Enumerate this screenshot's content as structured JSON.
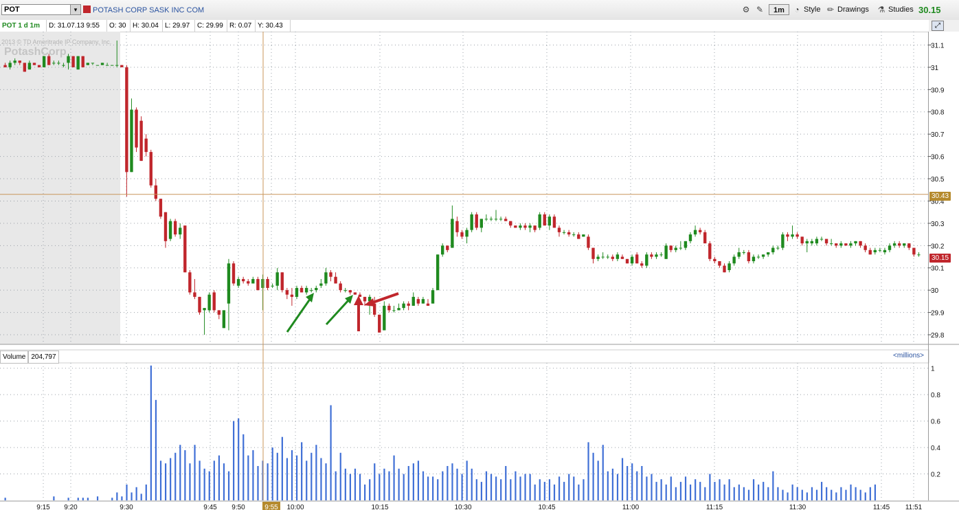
{
  "toolbar": {
    "symbol": "POT",
    "company": "POTASH CORP SASK INC COM",
    "timeframe_button": "1m",
    "style_label": "Style",
    "drawings_label": "Drawings",
    "studies_label": "Studies",
    "last_price": "30.15"
  },
  "info_bar": {
    "title": "POT 1 d 1m",
    "date": "D: 31.07.13 9:55",
    "open": "O: 30",
    "high": "H: 30.04",
    "low": "L: 29.97",
    "close": "C: 29.99",
    "range": "R: 0.07",
    "y": "Y: 30.43"
  },
  "watermark": {
    "copyright": "2013 © TD Ameritrade IP Company, Inc.",
    "logo": "PotashCorp"
  },
  "volume_panel": {
    "label": "Volume",
    "value": "204,797",
    "units": "<millions>"
  },
  "colors": {
    "up": "#1f8a1f",
    "down": "#c0262c",
    "volume": "#3f6fd6",
    "crosshair": "#c9955a",
    "grid": "#9aa0a8",
    "shade": "#e8e8e8"
  },
  "icons": [
    "dropdown-icon",
    "gear-icon",
    "wrench-icon",
    "bell-icon",
    "pencil-icon",
    "studies-icon",
    "expand-icon"
  ],
  "chart_data": {
    "type": "candlestick",
    "price_axis": {
      "ticks": [
        29.8,
        29.9,
        30,
        30.1,
        30.2,
        30.3,
        30.4,
        30.5,
        30.6,
        30.7,
        30.8,
        30.9,
        31,
        31.1
      ],
      "ylim": [
        29.76,
        31.16
      ]
    },
    "volume_axis": {
      "ticks": [
        0.2,
        0.4,
        0.6,
        0.8,
        1
      ],
      "labels": [
        "0.2",
        "0.4",
        "0.6",
        "0.8",
        "1"
      ],
      "ylim": [
        0,
        1.04
      ]
    },
    "time_labels": [
      "9:15",
      "9:20",
      "9:30",
      "9:45",
      "9:50",
      "9:55",
      "10:00",
      "10:15",
      "10:30",
      "10:45",
      "11:00",
      "11:15",
      "11:30",
      "11:45",
      "11:51"
    ],
    "crosshair_price": "30.43",
    "crosshair_time": "9:55",
    "last_price_tag": "30.15",
    "candles_ohlc": [
      [
        31.01,
        31.02,
        31.0,
        31.0
      ],
      [
        31.0,
        31.03,
        30.99,
        31.02
      ],
      [
        31.02,
        31.04,
        31.01,
        31.03
      ],
      [
        31.03,
        31.03,
        31.01,
        31.02
      ],
      [
        31.02,
        31.02,
        30.98,
        30.98
      ],
      [
        30.99,
        31.03,
        30.99,
        31.02
      ],
      [
        31.02,
        31.02,
        31.01,
        31.01
      ],
      [
        31.01,
        31.01,
        31.0,
        31.0
      ],
      [
        31.0,
        31.05,
        31.0,
        31.05
      ],
      [
        31.05,
        31.06,
        31.01,
        31.01
      ],
      [
        31.02,
        31.03,
        31.01,
        31.02
      ],
      [
        31.02,
        31.03,
        31.01,
        31.02
      ],
      [
        31.01,
        31.02,
        31.0,
        31.01
      ],
      [
        31.02,
        31.06,
        30.99,
        31.05
      ],
      [
        31.05,
        31.05,
        31.0,
        31.0
      ],
      [
        30.99,
        31.05,
        30.99,
        31.05
      ],
      [
        31.05,
        31.05,
        31.0,
        31.0
      ],
      [
        31.01,
        31.02,
        31.01,
        31.02
      ],
      [
        31.02,
        31.02,
        31.01,
        31.02
      ],
      [
        31.01,
        31.01,
        31.01,
        31.01
      ],
      [
        31.01,
        31.02,
        31.01,
        31.02
      ],
      [
        31.01,
        31.02,
        31.01,
        31.01
      ],
      [
        31.01,
        31.01,
        31.01,
        31.01
      ],
      [
        31.01,
        31.12,
        31.0,
        31.01
      ],
      [
        31.01,
        31.01,
        31.0,
        31.0
      ],
      [
        31.0,
        31.01,
        30.42,
        30.53
      ],
      [
        30.53,
        30.86,
        30.53,
        30.81
      ],
      [
        30.81,
        30.82,
        30.62,
        30.64
      ],
      [
        30.76,
        30.78,
        30.58,
        30.58
      ],
      [
        30.68,
        30.7,
        30.6,
        30.62
      ],
      [
        30.62,
        30.63,
        30.46,
        30.47
      ],
      [
        30.47,
        30.5,
        30.4,
        30.41
      ],
      [
        30.41,
        30.41,
        30.32,
        30.33
      ],
      [
        30.35,
        30.35,
        30.19,
        30.22
      ],
      [
        30.23,
        30.32,
        30.22,
        30.31
      ],
      [
        30.31,
        30.32,
        30.24,
        30.25
      ],
      [
        30.25,
        30.3,
        30.23,
        30.28
      ],
      [
        30.29,
        30.29,
        30.08,
        30.08
      ],
      [
        30.08,
        30.09,
        29.98,
        29.99
      ],
      [
        29.99,
        30.05,
        29.96,
        29.97
      ],
      [
        29.97,
        29.97,
        29.89,
        29.9
      ],
      [
        29.91,
        29.92,
        29.8,
        29.92
      ],
      [
        29.91,
        29.99,
        29.9,
        29.98
      ],
      [
        29.99,
        30.0,
        29.9,
        29.91
      ],
      [
        29.91,
        29.91,
        29.87,
        29.89
      ],
      [
        29.83,
        29.91,
        29.83,
        29.91
      ],
      [
        29.94,
        30.14,
        29.82,
        30.12
      ],
      [
        30.12,
        30.13,
        30.02,
        30.03
      ],
      [
        30.02,
        30.06,
        30.01,
        30.05
      ],
      [
        30.05,
        30.06,
        30.03,
        30.04
      ],
      [
        30.04,
        30.05,
        30.02,
        30.03
      ],
      [
        30.03,
        30.06,
        30.03,
        30.05
      ],
      [
        30.05,
        30.06,
        30.0,
        30.0
      ],
      [
        30.01,
        30.07,
        29.91,
        30.05
      ],
      [
        30.05,
        30.06,
        30.0,
        30.01
      ],
      [
        30.02,
        30.03,
        30.01,
        30.02
      ],
      [
        30.02,
        30.1,
        30.0,
        30.08
      ],
      [
        30.08,
        30.08,
        29.99,
        30.0
      ],
      [
        30.0,
        30.01,
        29.96,
        29.98
      ],
      [
        29.98,
        30.01,
        29.93,
        29.97
      ],
      [
        29.97,
        30.02,
        29.96,
        30.01
      ],
      [
        30.01,
        30.02,
        29.99,
        29.99
      ],
      [
        29.99,
        30.02,
        29.98,
        30.01
      ],
      [
        30.0,
        30.01,
        29.99,
        30.0
      ],
      [
        30.0,
        30.02,
        29.99,
        30.01
      ],
      [
        30.02,
        30.05,
        30.01,
        30.03
      ],
      [
        30.03,
        30.1,
        30.02,
        30.08
      ],
      [
        30.08,
        30.09,
        30.04,
        30.06
      ],
      [
        30.06,
        30.08,
        30.03,
        30.03
      ],
      [
        30.03,
        30.04,
        29.99,
        30.0
      ],
      [
        30.0,
        30.01,
        29.99,
        30.0
      ],
      [
        30.0,
        30.0,
        29.98,
        29.99
      ],
      [
        29.99,
        29.99,
        29.98,
        29.98
      ],
      [
        29.98,
        29.99,
        29.97,
        29.97
      ],
      [
        29.97,
        29.97,
        29.93,
        29.95
      ],
      [
        29.95,
        29.98,
        29.89,
        29.97
      ],
      [
        29.94,
        29.97,
        29.88,
        29.89
      ],
      [
        29.89,
        29.89,
        29.81,
        29.81
      ],
      [
        29.82,
        29.95,
        29.82,
        29.93
      ],
      [
        29.93,
        29.94,
        29.9,
        29.91
      ],
      [
        29.91,
        29.93,
        29.9,
        29.91
      ],
      [
        29.91,
        29.94,
        29.91,
        29.92
      ],
      [
        29.92,
        29.95,
        29.91,
        29.94
      ],
      [
        29.94,
        29.95,
        29.91,
        29.93
      ],
      [
        29.93,
        29.99,
        29.93,
        29.97
      ],
      [
        29.96,
        29.97,
        29.93,
        29.94
      ],
      [
        29.94,
        29.97,
        29.94,
        29.96
      ],
      [
        29.94,
        29.96,
        29.93,
        29.93
      ],
      [
        29.94,
        30.01,
        29.94,
        30.0
      ],
      [
        30.0,
        30.16,
        30.0,
        30.16
      ],
      [
        30.16,
        30.21,
        30.15,
        30.2
      ],
      [
        30.2,
        30.2,
        30.17,
        30.18
      ],
      [
        30.19,
        30.38,
        30.19,
        30.32
      ],
      [
        30.31,
        30.33,
        30.24,
        30.26
      ],
      [
        30.26,
        30.27,
        30.23,
        30.24
      ],
      [
        30.24,
        30.28,
        30.21,
        30.27
      ],
      [
        30.27,
        30.35,
        30.26,
        30.34
      ],
      [
        30.34,
        30.35,
        30.27,
        30.28
      ],
      [
        30.28,
        30.32,
        30.26,
        30.32
      ],
      [
        30.32,
        30.34,
        30.31,
        30.32
      ],
      [
        30.32,
        30.33,
        30.31,
        30.32
      ],
      [
        30.32,
        30.36,
        30.31,
        30.32
      ],
      [
        30.32,
        30.33,
        30.31,
        30.32
      ],
      [
        30.32,
        30.33,
        30.31,
        30.31
      ],
      [
        30.31,
        30.31,
        30.28,
        30.29
      ],
      [
        30.29,
        30.29,
        30.28,
        30.28
      ],
      [
        30.28,
        30.3,
        30.27,
        30.29
      ],
      [
        30.29,
        30.3,
        30.27,
        30.28
      ],
      [
        30.28,
        30.3,
        30.26,
        30.29
      ],
      [
        30.29,
        30.29,
        30.26,
        30.27
      ],
      [
        30.28,
        30.35,
        30.27,
        30.34
      ],
      [
        30.34,
        30.35,
        30.29,
        30.29
      ],
      [
        30.29,
        30.34,
        30.27,
        30.33
      ],
      [
        30.33,
        30.34,
        30.28,
        30.28
      ],
      [
        30.28,
        30.29,
        30.24,
        30.26
      ],
      [
        30.26,
        30.27,
        30.25,
        30.26
      ],
      [
        30.26,
        30.27,
        30.24,
        30.25
      ],
      [
        30.25,
        30.26,
        30.24,
        30.25
      ],
      [
        30.25,
        30.26,
        30.23,
        30.23
      ],
      [
        30.24,
        30.25,
        30.24,
        30.25
      ],
      [
        30.24,
        30.25,
        30.18,
        30.19
      ],
      [
        30.19,
        30.19,
        30.12,
        30.14
      ],
      [
        30.14,
        30.16,
        30.13,
        30.15
      ],
      [
        30.15,
        30.17,
        30.14,
        30.15
      ],
      [
        30.15,
        30.16,
        30.14,
        30.15
      ],
      [
        30.15,
        30.16,
        30.13,
        30.14
      ],
      [
        30.14,
        30.17,
        30.13,
        30.16
      ],
      [
        30.15,
        30.16,
        30.14,
        30.14
      ],
      [
        30.14,
        30.14,
        30.12,
        30.12
      ],
      [
        30.12,
        30.16,
        30.11,
        30.15
      ],
      [
        30.16,
        30.17,
        30.12,
        30.12
      ],
      [
        30.12,
        30.13,
        30.1,
        30.11
      ],
      [
        30.11,
        30.17,
        30.1,
        30.16
      ],
      [
        30.16,
        30.17,
        30.14,
        30.15
      ],
      [
        30.15,
        30.17,
        30.14,
        30.16
      ],
      [
        30.16,
        30.17,
        30.15,
        30.16
      ],
      [
        30.14,
        30.21,
        30.14,
        30.2
      ],
      [
        30.2,
        30.2,
        30.17,
        30.18
      ],
      [
        30.18,
        30.2,
        30.17,
        30.19
      ],
      [
        30.19,
        30.22,
        30.18,
        30.19
      ],
      [
        30.19,
        30.22,
        30.18,
        30.22
      ],
      [
        30.22,
        30.26,
        30.21,
        30.25
      ],
      [
        30.25,
        30.29,
        30.24,
        30.27
      ],
      [
        30.27,
        30.28,
        30.25,
        30.26
      ],
      [
        30.26,
        30.27,
        30.21,
        30.21
      ],
      [
        30.21,
        30.22,
        30.13,
        30.14
      ],
      [
        30.14,
        30.15,
        30.12,
        30.13
      ],
      [
        30.13,
        30.13,
        30.1,
        30.11
      ],
      [
        30.11,
        30.12,
        30.08,
        30.08
      ],
      [
        30.09,
        30.13,
        30.08,
        30.12
      ],
      [
        30.12,
        30.16,
        30.11,
        30.15
      ],
      [
        30.15,
        30.19,
        30.14,
        30.17
      ],
      [
        30.17,
        30.18,
        30.16,
        30.17
      ],
      [
        30.17,
        30.18,
        30.12,
        30.13
      ],
      [
        30.13,
        30.16,
        30.12,
        30.15
      ],
      [
        30.15,
        30.16,
        30.14,
        30.15
      ],
      [
        30.15,
        30.16,
        30.14,
        30.16
      ],
      [
        30.16,
        30.17,
        30.15,
        30.17
      ],
      [
        30.17,
        30.2,
        30.16,
        30.19
      ],
      [
        30.19,
        30.2,
        30.18,
        30.19
      ],
      [
        30.19,
        30.26,
        30.18,
        30.25
      ],
      [
        30.25,
        30.26,
        30.22,
        30.24
      ],
      [
        30.24,
        30.29,
        30.23,
        30.25
      ],
      [
        30.25,
        30.26,
        30.23,
        30.24
      ],
      [
        30.24,
        30.24,
        30.2,
        30.21
      ],
      [
        30.21,
        30.23,
        30.17,
        30.22
      ],
      [
        30.21,
        30.23,
        30.2,
        30.22
      ],
      [
        30.21,
        30.24,
        30.2,
        30.23
      ],
      [
        30.23,
        30.24,
        30.22,
        30.23
      ],
      [
        30.23,
        30.23,
        30.2,
        30.21
      ],
      [
        30.21,
        30.23,
        30.2,
        30.21
      ],
      [
        30.21,
        30.21,
        30.19,
        30.2
      ],
      [
        30.2,
        30.22,
        30.19,
        30.21
      ],
      [
        30.21,
        30.21,
        30.2,
        30.2
      ],
      [
        30.2,
        30.22,
        30.19,
        30.21
      ],
      [
        30.21,
        30.22,
        30.2,
        30.22
      ],
      [
        30.22,
        30.22,
        30.19,
        30.2
      ],
      [
        30.2,
        30.21,
        30.17,
        30.18
      ],
      [
        30.18,
        30.19,
        30.16,
        30.16
      ],
      [
        30.17,
        30.19,
        30.16,
        30.18
      ],
      [
        30.18,
        30.19,
        30.17,
        30.18
      ],
      [
        30.17,
        30.19,
        30.16,
        30.18
      ],
      [
        30.18,
        30.21,
        30.17,
        30.2
      ],
      [
        30.2,
        30.22,
        30.19,
        30.21
      ],
      [
        30.21,
        30.22,
        30.19,
        30.2
      ],
      [
        30.2,
        30.21,
        30.19,
        30.21
      ],
      [
        30.21,
        30.21,
        30.18,
        30.19
      ],
      [
        30.19,
        30.19,
        30.15,
        30.16
      ],
      [
        30.16,
        30.17,
        30.15,
        30.16
      ]
    ],
    "volume_millions": [
      0.02,
      0.0,
      0.0,
      0.0,
      0.0,
      0.0,
      0.0,
      0.0,
      0.0,
      0.0,
      0.03,
      0.0,
      0.0,
      0.02,
      0.0,
      0.02,
      0.02,
      0.02,
      0.0,
      0.03,
      0.0,
      0.0,
      0.02,
      0.06,
      0.03,
      0.12,
      0.06,
      0.1,
      0.05,
      0.12,
      1.02,
      0.76,
      0.3,
      0.28,
      0.32,
      0.36,
      0.42,
      0.38,
      0.28,
      0.42,
      0.3,
      0.24,
      0.22,
      0.3,
      0.34,
      0.28,
      0.22,
      0.6,
      0.62,
      0.5,
      0.34,
      0.38,
      0.26,
      0.3,
      0.28,
      0.4,
      0.36,
      0.48,
      0.32,
      0.38,
      0.34,
      0.44,
      0.3,
      0.36,
      0.42,
      0.32,
      0.28,
      0.72,
      0.22,
      0.36,
      0.24,
      0.2,
      0.24,
      0.2,
      0.12,
      0.16,
      0.28,
      0.2,
      0.24,
      0.22,
      0.34,
      0.24,
      0.2,
      0.26,
      0.28,
      0.3,
      0.22,
      0.18,
      0.18,
      0.16,
      0.22,
      0.26,
      0.28,
      0.24,
      0.2,
      0.3,
      0.24,
      0.16,
      0.14,
      0.22,
      0.2,
      0.18,
      0.16,
      0.26,
      0.16,
      0.22,
      0.18,
      0.2,
      0.2,
      0.12,
      0.16,
      0.14,
      0.16,
      0.12,
      0.18,
      0.14,
      0.2,
      0.18,
      0.12,
      0.16,
      0.44,
      0.36,
      0.3,
      0.42,
      0.22,
      0.24,
      0.2,
      0.32,
      0.26,
      0.28,
      0.22,
      0.26,
      0.18,
      0.2,
      0.14,
      0.16,
      0.12,
      0.18,
      0.1,
      0.14,
      0.18,
      0.12,
      0.16,
      0.14,
      0.1,
      0.2,
      0.14,
      0.16,
      0.12,
      0.16,
      0.1,
      0.12,
      0.1,
      0.08,
      0.16,
      0.12,
      0.14,
      0.1,
      0.22,
      0.1,
      0.08,
      0.06,
      0.12,
      0.1,
      0.08,
      0.06,
      0.1,
      0.08,
      0.14,
      0.1,
      0.08,
      0.06,
      0.1,
      0.08,
      0.12,
      0.1,
      0.08,
      0.06,
      0.1,
      0.12
    ]
  }
}
